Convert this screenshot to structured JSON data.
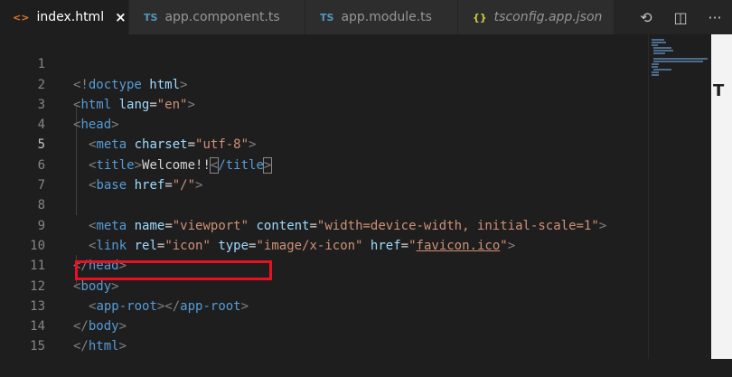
{
  "tabs": [
    {
      "icon": "<>",
      "label": "index.html",
      "close": "×",
      "active": true
    },
    {
      "icon": "TS",
      "label": "app.component.ts"
    },
    {
      "icon": "TS",
      "label": "app.module.ts"
    },
    {
      "icon": "{}",
      "label": "tsconfig.app.json"
    }
  ],
  "tab_actions": {
    "compare": "⟲",
    "split": "◫",
    "more": "···"
  },
  "editor": {
    "line_numbers": [
      "1",
      "2",
      "3",
      "4",
      "5",
      "6",
      "7",
      "8",
      "9",
      "10",
      "11",
      "12",
      "13",
      "14",
      "15"
    ],
    "lines": {
      "l1": {
        "a": "<!",
        "b": "doctype",
        "c": " html",
        "d": ">"
      },
      "l2": {
        "a": "<",
        "b": "html",
        "c": " lang",
        "d": "=",
        "e": "\"en\"",
        "f": ">"
      },
      "l3": {
        "a": "<",
        "b": "head",
        "c": ">"
      },
      "l4": {
        "a": "<",
        "b": "meta",
        "c": " charset",
        "d": "=",
        "e": "\"utf-8\"",
        "f": ">"
      },
      "l5": {
        "a": "<",
        "b": "title",
        "c": ">",
        "d": "Welcome!!",
        "e": "<",
        "f": "/title",
        "g": ">"
      },
      "l6": {
        "a": "<",
        "b": "base",
        "c": " href",
        "d": "=",
        "e": "\"/\"",
        "f": ">"
      },
      "l8": {
        "a": "<",
        "b": "meta",
        "c": " name",
        "d": "=",
        "e": "\"viewport\"",
        "f": " content",
        "g": "=",
        "h": "\"width=device-width, initial-scale=1\"",
        "i": ">"
      },
      "l9": {
        "a": "<",
        "b": "link",
        "c": " rel",
        "d": "=",
        "e": "\"icon\"",
        "f": " type",
        "g": "=",
        "h": "\"image/x-icon\"",
        "i": " href",
        "j": "=",
        "k": "\"",
        "l": "favicon.ico",
        "m": "\"",
        "n": ">"
      },
      "l10": {
        "a": "</",
        "b": "head",
        "c": ">"
      },
      "l11": {
        "a": "<",
        "b": "body",
        "c": ">"
      },
      "l12": {
        "a": "<",
        "b": "app-root",
        "c": "></",
        "d": "app-root",
        "e": ">"
      },
      "l13": {
        "a": "</",
        "b": "body",
        "c": ">"
      },
      "l14": {
        "a": "</",
        "b": "html",
        "c": ">"
      }
    }
  },
  "side_letter": "T"
}
